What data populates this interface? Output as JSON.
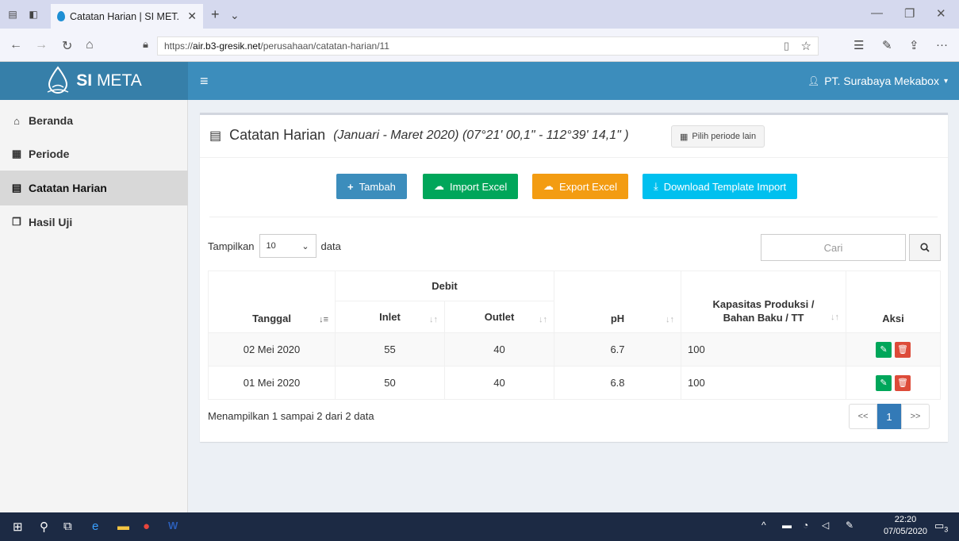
{
  "browser": {
    "tab_title": "Catatan Harian | SI MET.",
    "url_prefix": "https://",
    "url_domain": "air.b3-gresik.net",
    "url_path": "/perusahaan/catatan-harian/11"
  },
  "header": {
    "logo_text_bold": "SI",
    "logo_text": " META",
    "user_name": "PT. Surabaya Mekabox"
  },
  "sidebar": {
    "items": [
      {
        "label": "Beranda",
        "icon": "home-icon"
      },
      {
        "label": "Periode",
        "icon": "calendar-icon"
      },
      {
        "label": "Catatan Harian",
        "icon": "document-icon",
        "active": true
      },
      {
        "label": "Hasil Uji",
        "icon": "copy-icon"
      }
    ]
  },
  "main": {
    "title": "Catatan Harian",
    "subtitle": "(Januari - Maret 2020) (07°21' 00,1\" - 112°39' 14,1\" )",
    "periode_button": "Pilih periode lain",
    "buttons": {
      "tambah": "Tambah",
      "import": "Import Excel",
      "export": "Export Excel",
      "download": "Download Template Import"
    },
    "length_label_before": "Tampilkan",
    "length_value": "10",
    "length_label_after": "data",
    "search_placeholder": "Cari",
    "table": {
      "headers": {
        "tanggal": "Tanggal",
        "debit": "Debit",
        "inlet": "Inlet",
        "outlet": "Outlet",
        "ph": "pH",
        "kapasitas_line1": "Kapasitas Produksi /",
        "kapasitas_line2": "Bahan Baku / TT",
        "aksi": "Aksi"
      },
      "rows": [
        {
          "tanggal": "02 Mei 2020",
          "inlet": "55",
          "outlet": "40",
          "ph": "6.7",
          "kapasitas": "100"
        },
        {
          "tanggal": "01 Mei 2020",
          "inlet": "50",
          "outlet": "40",
          "ph": "6.8",
          "kapasitas": "100"
        }
      ]
    },
    "info": "Menampilkan 1 sampai 2 dari 2 data",
    "pager": {
      "prev": "<<",
      "current": "1",
      "next": ">>"
    }
  },
  "taskbar": {
    "time": "22:20",
    "date": "07/05/2020",
    "notifications": "3"
  },
  "colors": {
    "header": "#3c8dbc",
    "logo_bg": "#367fa9",
    "btn_blue": "#3c8dbc",
    "btn_green": "#00a65a",
    "btn_orange": "#f39c12",
    "btn_cyan": "#00c0ef",
    "delete": "#dd4b39"
  }
}
